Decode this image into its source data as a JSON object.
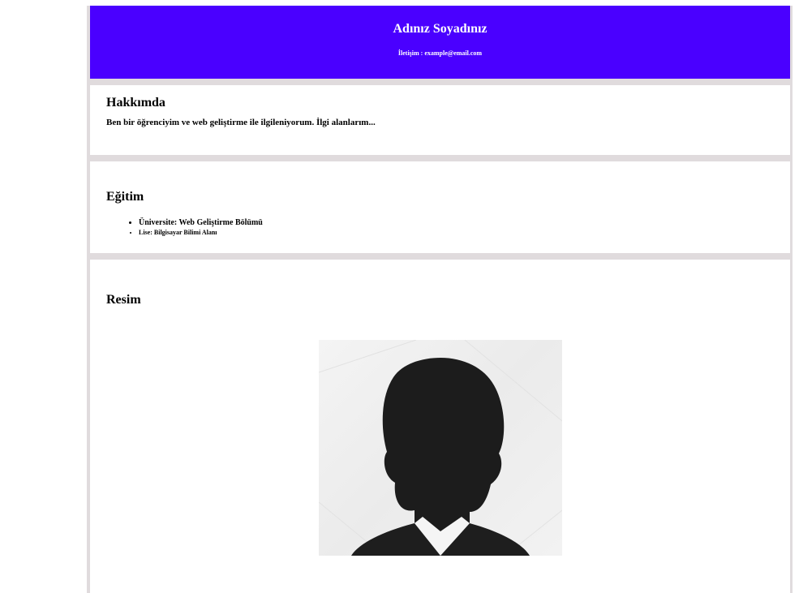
{
  "header": {
    "name": "Adınız Soyadınız",
    "contact": "İletişim : example@email.com"
  },
  "about": {
    "title": "Hakkımda",
    "text": "Ben bir öğrenciyim ve web geliştirme ile ilgileniyorum. İlgi alanlarım..."
  },
  "education": {
    "title": "Eğitim",
    "items": [
      "Üniversite: Web Geliştirme Bölümü",
      "Lise: Bilgisayar Bilimi Alanı"
    ]
  },
  "image_section": {
    "title": "Resim",
    "image": "person-silhouette"
  },
  "colors": {
    "header_bg": "#4a00ff",
    "frame": "#e0dbdd"
  }
}
